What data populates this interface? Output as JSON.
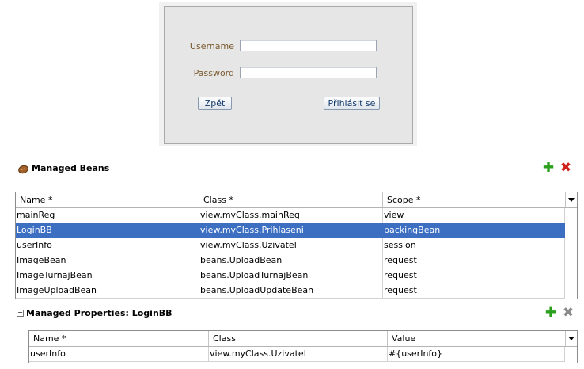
{
  "login_form": {
    "username_label": "Username",
    "password_label": "Password",
    "username_value": "",
    "password_value": "",
    "back_button": "Zpět",
    "submit_button": "Přihlásit se"
  },
  "managed_beans": {
    "title": "Managed Beans",
    "icon": "bean-icon",
    "columns": [
      "Name *",
      "Class *",
      "Scope *"
    ],
    "rows": [
      {
        "name": "mainReg",
        "class": "view.myClass.mainReg",
        "scope": "view"
      },
      {
        "name": "LoginBB",
        "class": "view.myClass.Prihlaseni",
        "scope": "backingBean"
      },
      {
        "name": "userInfo",
        "class": "view.myClass.Uzivatel",
        "scope": "session"
      },
      {
        "name": "ImageBean",
        "class": "beans.UploadBean",
        "scope": "request"
      },
      {
        "name": "ImageTurnajBean",
        "class": "beans.UploadTurnajBean",
        "scope": "request"
      },
      {
        "name": "ImageUploadBean",
        "class": "beans.UploadUpdateBean",
        "scope": "request"
      }
    ],
    "selected_row_index": 1,
    "selection_color": "#3c6fc2"
  },
  "managed_properties": {
    "title": "Managed Properties: LoginBB",
    "columns": [
      "Name *",
      "Class",
      "Value"
    ],
    "rows": [
      {
        "name": "userInfo",
        "class": "view.myClass.Uzivatel",
        "value": "#{userInfo}"
      }
    ]
  },
  "icons": {
    "add": "plus-icon",
    "delete": "x-icon",
    "collapse": "collapse-toggle-icon",
    "column_menu": "chevron-down-icon"
  },
  "colors": {
    "add": "#2aa01c",
    "delete": "#d0201b",
    "delete_disabled": "#8a8a8a",
    "label": "#7a5a2e"
  }
}
